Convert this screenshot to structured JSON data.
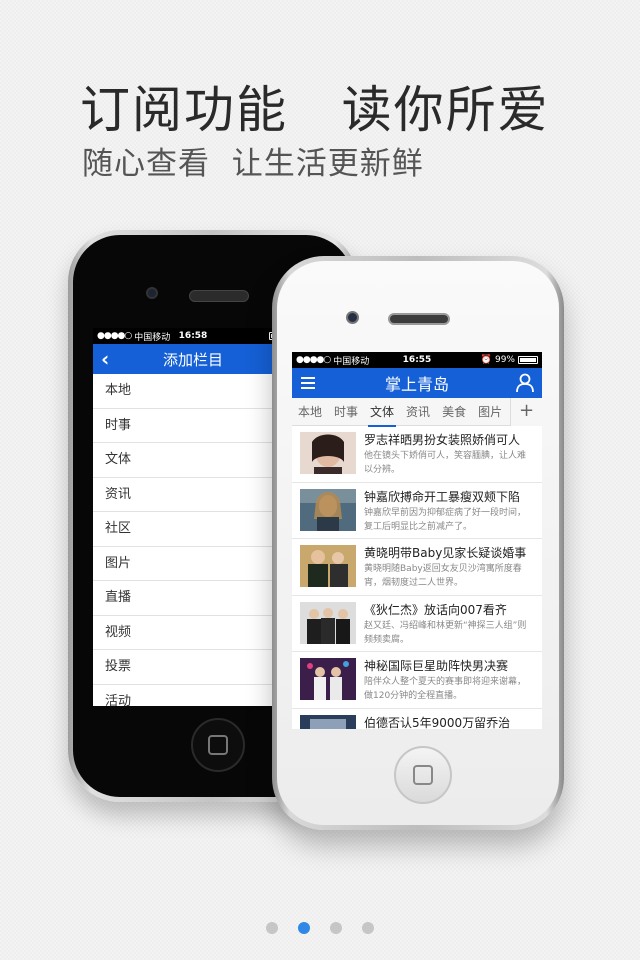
{
  "headline": "订阅功能   读你所爱",
  "subline": "随心查看  让生活更新鲜",
  "phone_a": {
    "status": {
      "signal": "●●●●○",
      "carrier": "中国移动",
      "time": "16:58"
    },
    "nav_title": "添加栏目",
    "channels": [
      "本地",
      "时事",
      "文体",
      "资讯",
      "社区",
      "图片",
      "直播",
      "视频",
      "投票",
      "活动"
    ]
  },
  "phone_b": {
    "status": {
      "signal": "●●●●○",
      "carrier": "中国移动",
      "time": "16:55",
      "battery": "99%"
    },
    "nav_title": "掌上青岛",
    "tabs": [
      "本地",
      "时事",
      "文体",
      "资讯",
      "美食",
      "图片"
    ],
    "active_tab": "文体",
    "add_label": "+",
    "news": [
      {
        "title": "罗志祥晒男扮女装照娇俏可人",
        "desc1": "他在镜头下娇俏可人，笑容腼腆，让人难",
        "desc2": "以分辨。"
      },
      {
        "title": "钟嘉欣搏命开工暴瘦双颊下陷",
        "desc1": "钟嘉欣早前因为抑郁症病了好一段时间，",
        "desc2": "复工后明显比之前减产了。"
      },
      {
        "title": "黄晓明带Baby见家长疑谈婚事",
        "desc1": "黄晓明随Baby返回女友贝沙湾寓所度春",
        "desc2": "宵，烟韧度过二人世界。"
      },
      {
        "title": "《狄仁杰》放话向007看齐",
        "desc1": "赵又廷、冯绍峰和林更新“神探三人组”则",
        "desc2": "频频卖腐。"
      },
      {
        "title": "神秘国际巨星助阵快男决赛",
        "desc1": "陪伴众人整个夏天的赛事即将迎来谢幕，",
        "desc2": "做120分钟的全程直播。"
      },
      {
        "title": "伯德否认5年9000万留乔治",
        "desc1": "",
        "desc2": ""
      }
    ]
  },
  "pagination": {
    "count": 4,
    "active": 1
  }
}
